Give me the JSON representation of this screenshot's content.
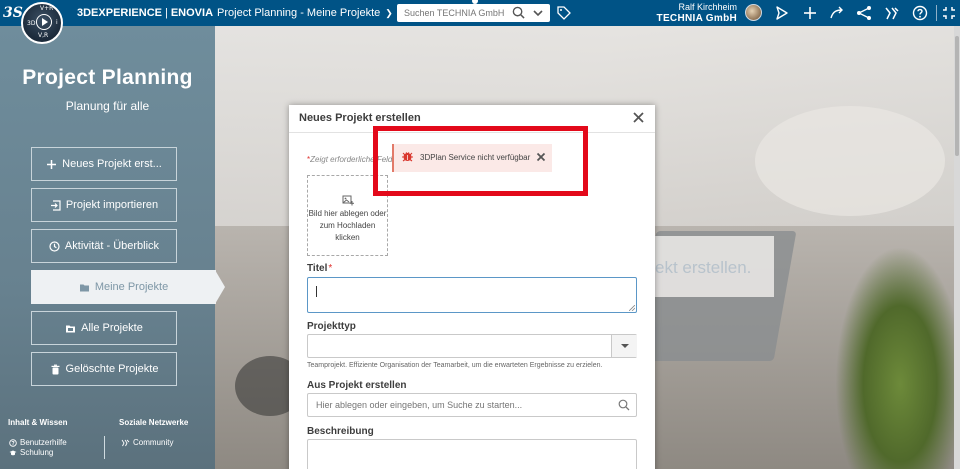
{
  "topbar": {
    "ds_logo": "3S",
    "compass": {
      "top": "V+R",
      "left": "3D",
      "right": "i",
      "bottom": "V,R"
    },
    "brand_3dx": "3DEXPERIENCE",
    "brand_sep": "|",
    "brand_enovia": "ENOVIA",
    "app_title": "Project Planning - Meine Projekte",
    "search_placeholder": "Suchen TECHNIA GmbH",
    "user_name": "Ralf Kirchheim",
    "user_company": "TECHNIA GmbH",
    "icons": [
      "tag-icon",
      "share-icon",
      "plus-icon",
      "send-icon",
      "network-icon",
      "tools-icon",
      "help-icon",
      "fullscreen-icon"
    ]
  },
  "sidebar": {
    "title": "Project Planning",
    "subtitle": "Planung für alle",
    "items": [
      {
        "label": "Neues Projekt erst...",
        "icon": "plus-icon"
      },
      {
        "label": "Projekt importieren",
        "icon": "import-icon"
      },
      {
        "label": "Aktivität - Überblick",
        "icon": "clock-icon"
      },
      {
        "label": "Meine Projekte",
        "icon": "folder-icon",
        "active": true
      },
      {
        "label": "Alle Projekte",
        "icon": "folders-icon"
      },
      {
        "label": "Gelöschte Projekte",
        "icon": "trash-icon"
      }
    ],
    "footer": {
      "col1_heading": "Inhalt & Wissen",
      "col1_links": [
        "Benutzerhilfe",
        "Schulung"
      ],
      "col2_heading": "Soziale Netzwerke",
      "col2_links": [
        "Community"
      ]
    }
  },
  "background": {
    "banner_text": "ekt erstellen."
  },
  "modal": {
    "title": "Neues Projekt erstellen",
    "required_note": "Zeigt erforderliche Felder",
    "dropzone_text": "Bild hier ablegen oder zum Hochladen klicken",
    "title_label": "Titel",
    "title_value": "",
    "projecttype_label": "Projekttyp",
    "projecttype_value": "",
    "projecttype_hint": "Teamprojekt. Effiziente Organisation der Teamarbeit, um die erwarteten Ergebnisse zu erzielen.",
    "from_project_label": "Aus Projekt erstellen",
    "from_project_placeholder": "Hier ablegen oder eingeben, um Suche zu starten...",
    "description_label": "Beschreibung"
  },
  "notification": {
    "text": "3DPlan Service nicht verfügbar",
    "type": "error",
    "color": "#e3091a"
  }
}
